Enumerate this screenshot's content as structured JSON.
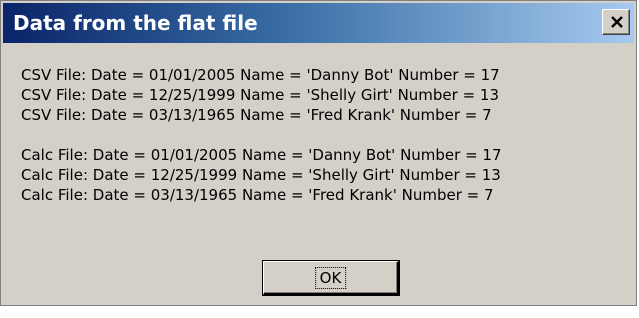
{
  "dialog": {
    "title": "Data from the flat file",
    "close_icon": "close-icon",
    "colors": {
      "titlebar_start": "#0a246a",
      "titlebar_end": "#a6caf0",
      "face": "#d4d0c8"
    }
  },
  "message": {
    "csv_lines": [
      "CSV File: Date = 01/01/2005 Name = 'Danny Bot' Number = 17",
      "CSV File: Date = 12/25/1999 Name = 'Shelly Girt' Number = 13",
      "CSV File: Date = 03/13/1965 Name = 'Fred Krank' Number = 7"
    ],
    "calc_lines": [
      "Calc File: Date = 01/01/2005 Name = 'Danny Bot' Number = 17",
      "Calc File: Date = 12/25/1999 Name = 'Shelly Girt' Number = 13",
      "Calc File: Date = 03/13/1965 Name = 'Fred Krank' Number = 7"
    ]
  },
  "buttons": {
    "ok_label": "OK"
  }
}
